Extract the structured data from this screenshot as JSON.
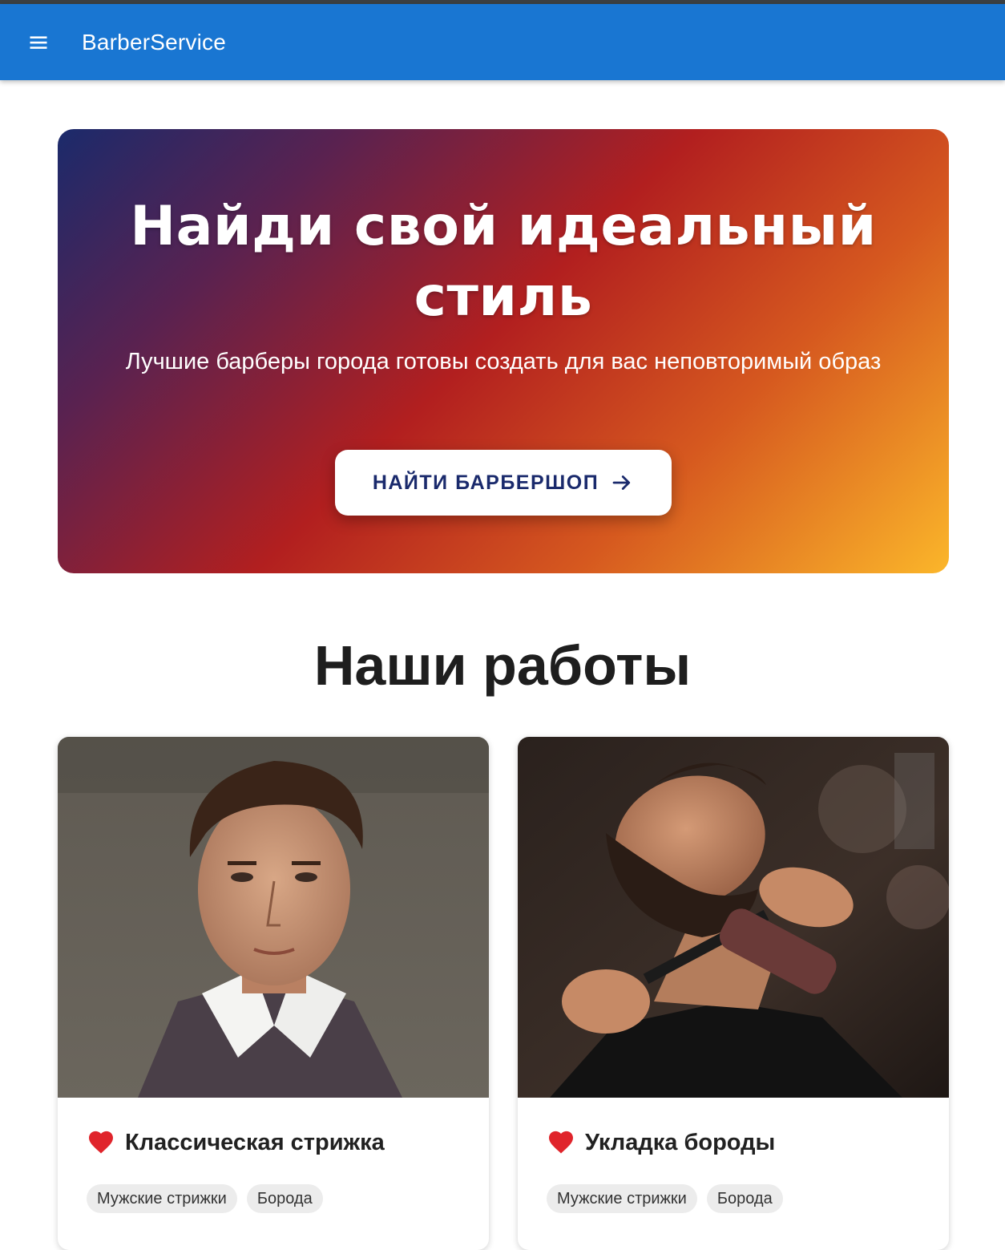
{
  "appbar": {
    "title": "BarberService",
    "menu_icon": "hamburger-menu-icon",
    "color": "#1976d2"
  },
  "hero": {
    "title": "Найди свой идеальный стиль",
    "subtitle": "Лучшие барберы города готовы создать для вас неповторимый образ",
    "cta_label": "НАЙТИ БАРБЕРШОП",
    "cta_icon": "arrow-right-icon",
    "gradient": [
      "#1b2a6b",
      "#b21f1f",
      "#fbb62a"
    ]
  },
  "works": {
    "title": "Наши работы",
    "cards": [
      {
        "title": "Классическая стрижка",
        "icon": "heart-icon",
        "tags": [
          "Мужские стрижки",
          "Борода"
        ]
      },
      {
        "title": "Укладка бороды",
        "icon": "heart-icon",
        "tags": [
          "Мужские стрижки",
          "Борода"
        ]
      }
    ]
  },
  "colors": {
    "heart": "#e0242b",
    "chip_bg": "#ececec"
  }
}
